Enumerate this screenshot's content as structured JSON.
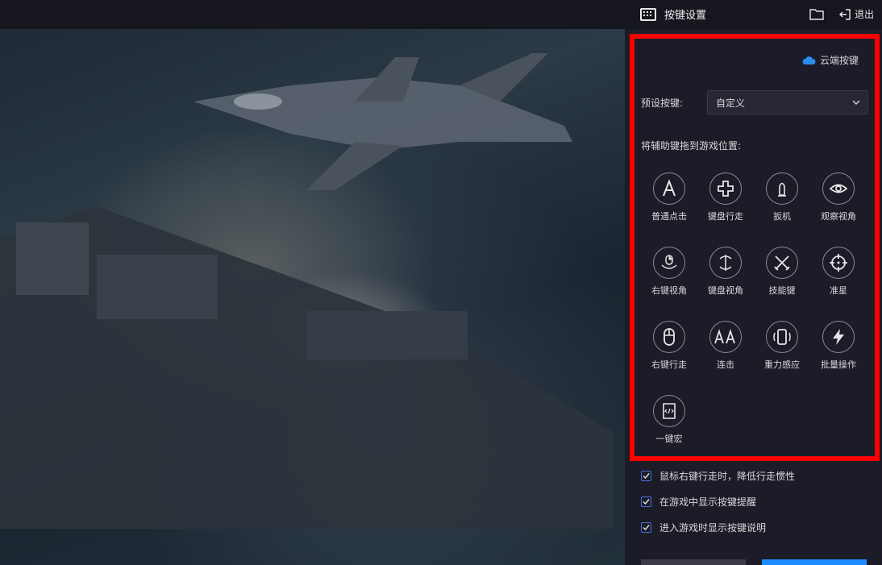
{
  "header": {
    "title": "按键设置",
    "exit_label": "退出",
    "icons": [
      "keyboard-icon",
      "folder-icon",
      "exit-icon"
    ]
  },
  "panel": {
    "cloud_label": "云端按键",
    "preset_label": "预设按键:",
    "preset_value": "自定义",
    "drag_label": "将辅助键拖到游戏位置:",
    "tools": [
      {
        "label": "普通点击",
        "icon": "letter-a-icon"
      },
      {
        "label": "键盘行走",
        "icon": "dpad-icon"
      },
      {
        "label": "扳机",
        "icon": "bullet-icon"
      },
      {
        "label": "观察视角",
        "icon": "eye-icon"
      },
      {
        "label": "右键视角",
        "icon": "mouse-rotate-icon"
      },
      {
        "label": "键盘视角",
        "icon": "rotate-view-icon"
      },
      {
        "label": "技能键",
        "icon": "crossed-swords-icon"
      },
      {
        "label": "准星",
        "icon": "crosshair-icon"
      },
      {
        "label": "右键行走",
        "icon": "mouse-icon"
      },
      {
        "label": "连击",
        "icon": "double-a-icon"
      },
      {
        "label": "重力感应",
        "icon": "phone-tilt-icon"
      },
      {
        "label": "批量操作",
        "icon": "lightning-icon"
      },
      {
        "label": "一键宏",
        "icon": "macro-script-icon"
      }
    ],
    "checkboxes": [
      {
        "label": "鼠标右键行走时，降低行走惯性",
        "checked": true
      },
      {
        "label": "在游戏中显示按键提醒",
        "checked": true
      },
      {
        "label": "进入游戏时显示按键说明",
        "checked": true
      }
    ]
  },
  "colors": {
    "highlight": "#ff0000",
    "accent": "#1a8cff",
    "cloud": "#2b8cf0"
  }
}
